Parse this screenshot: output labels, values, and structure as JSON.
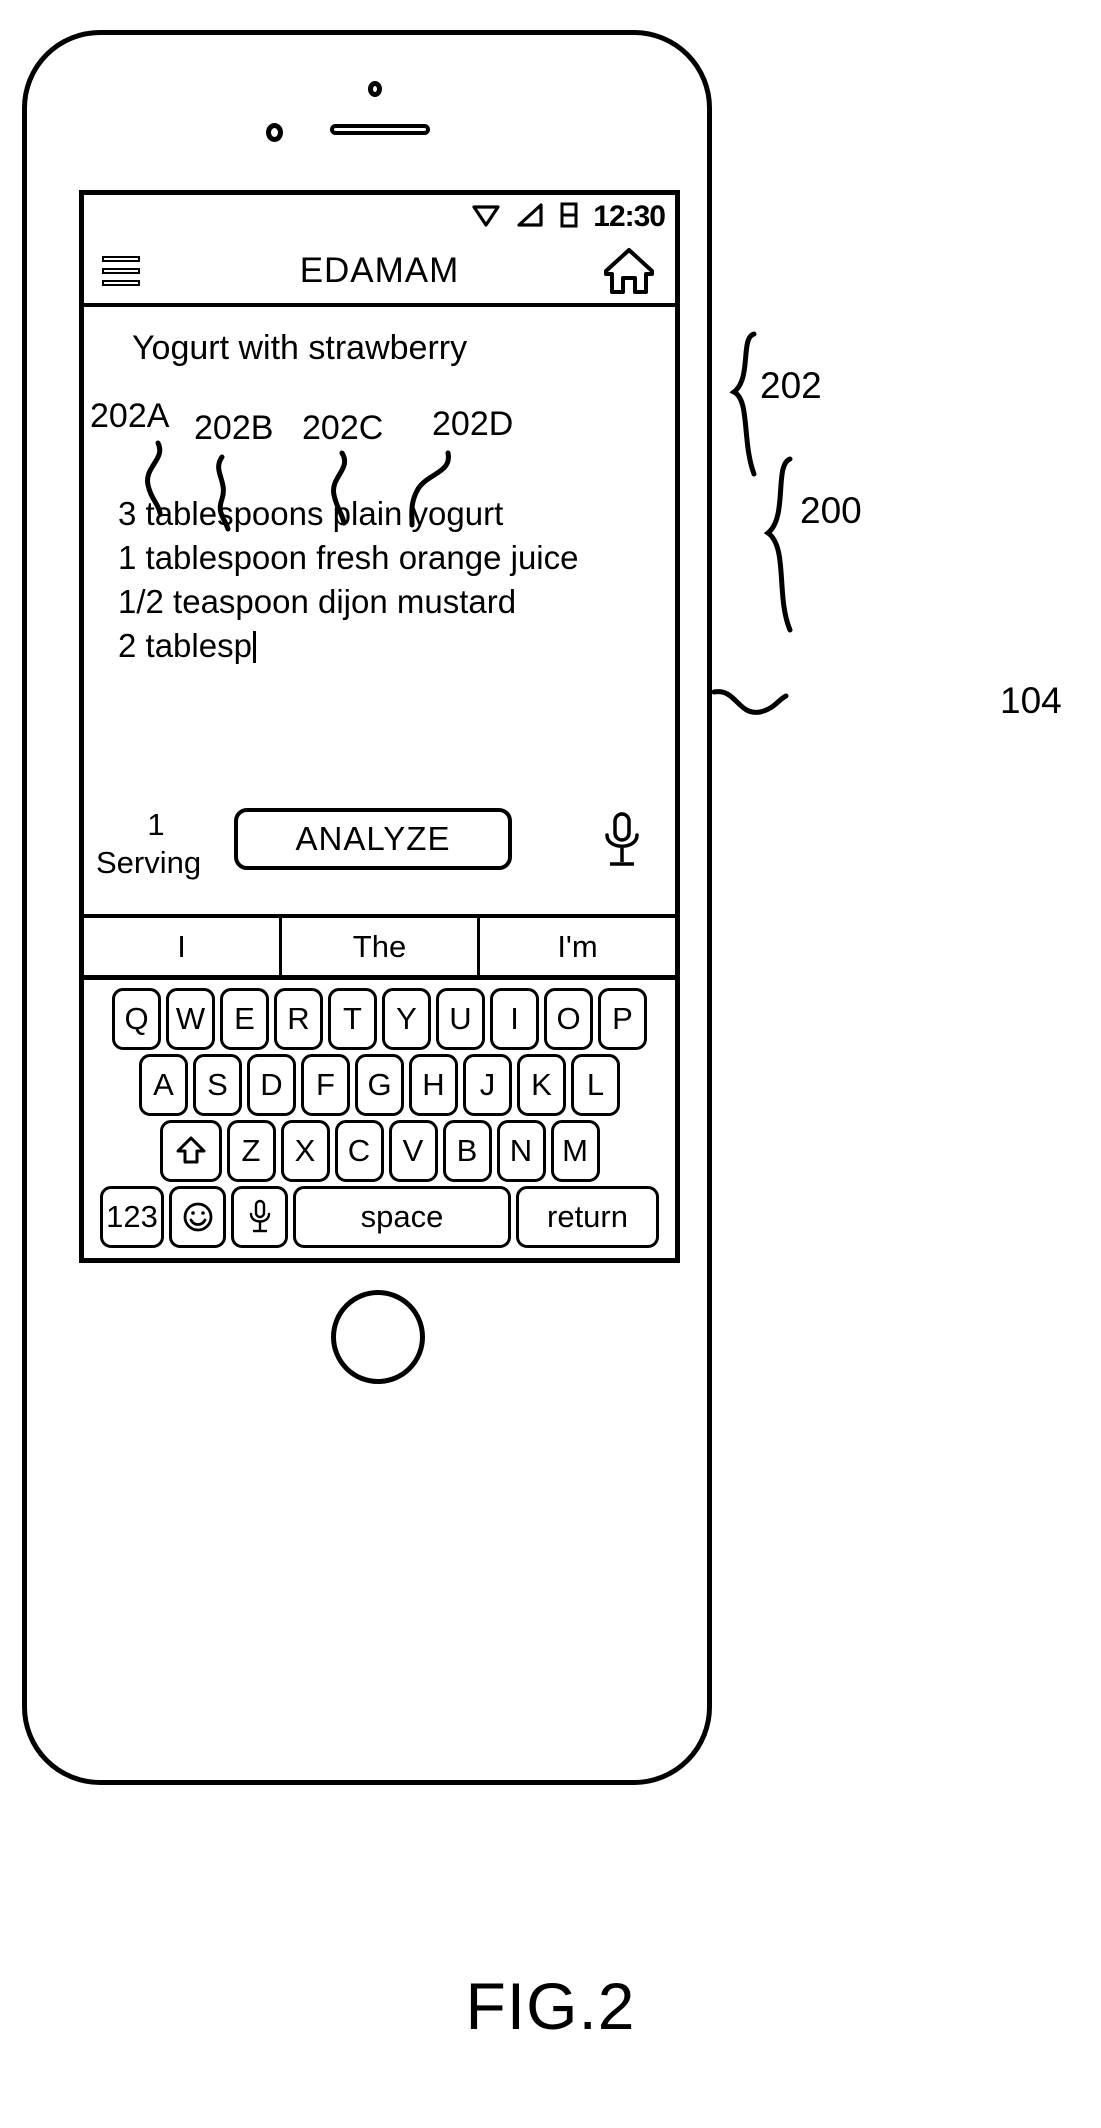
{
  "figure": {
    "caption": "FIG.2",
    "reference_numbers": {
      "device": "104",
      "ingredient_list": "200",
      "recipe_title_group": "202",
      "token_a": "202A",
      "token_b": "202B",
      "token_c": "202C",
      "token_d": "202D"
    }
  },
  "device": {
    "name": "smartphone",
    "hardware": {
      "earpiece_speaker": "speaker-slot",
      "front_camera": "camera-icon",
      "proximity_sensor": "sensor-icon",
      "home_button": "home-button"
    }
  },
  "status_bar": {
    "time": "12:30",
    "icons": [
      "wifi-icon",
      "signal-icon",
      "battery-icon"
    ]
  },
  "app_header": {
    "menu_icon": "hamburger-menu-icon",
    "title": "EDAMAM",
    "home_icon": "home-icon"
  },
  "recipe": {
    "title": "Yogurt with strawberry",
    "ingredients": [
      "3 tablespoons plain yogurt",
      "1 tablespoon fresh orange juice",
      "1/2 teaspoon dijon mustard",
      "2 tablesp"
    ],
    "cursor_visible": true
  },
  "action_row": {
    "serving_number": "1",
    "serving_label": "Serving",
    "analyze_label": "ANALYZE",
    "mic_icon": "microphone-icon"
  },
  "keyboard": {
    "suggestions": [
      "I",
      "The",
      "I'm"
    ],
    "rows": [
      [
        "Q",
        "W",
        "E",
        "R",
        "T",
        "Y",
        "U",
        "I",
        "O",
        "P"
      ],
      [
        "A",
        "S",
        "D",
        "F",
        "G",
        "H",
        "J",
        "K",
        "L"
      ],
      [
        "Z",
        "X",
        "C",
        "V",
        "B",
        "N",
        "M"
      ]
    ],
    "shift_icon": "shift-arrow-icon",
    "numeric_label": "123",
    "emoji_icon": "smiley-face-icon",
    "mic_icon": "microphone-icon",
    "space_label": "space",
    "return_label": "return"
  },
  "colors": {
    "line": "#000000",
    "background": "#ffffff"
  }
}
